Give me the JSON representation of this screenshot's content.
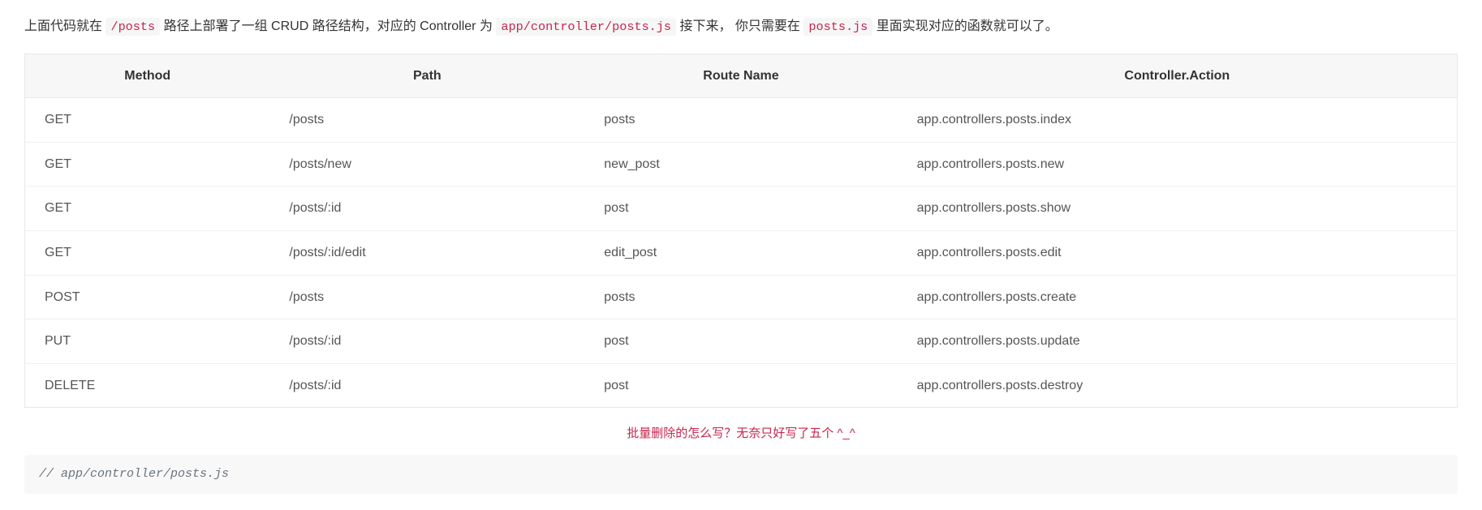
{
  "intro": {
    "part1": "上面代码就在 ",
    "code1": "/posts",
    "part2": " 路径上部署了一组 CRUD 路径结构，对应的 Controller 为 ",
    "code2": "app/controller/posts.js",
    "part3": " 接下来， 你只需要在 ",
    "code3": "posts.js",
    "part4": " 里面实现对应的函数就可以了。"
  },
  "table": {
    "headers": [
      "Method",
      "Path",
      "Route Name",
      "Controller.Action"
    ],
    "rows": [
      {
        "method": "GET",
        "path": "/posts",
        "route_name": "posts",
        "action": "app.controllers.posts.index"
      },
      {
        "method": "GET",
        "path": "/posts/new",
        "route_name": "new_post",
        "action": "app.controllers.posts.new"
      },
      {
        "method": "GET",
        "path": "/posts/:id",
        "route_name": "post",
        "action": "app.controllers.posts.show"
      },
      {
        "method": "GET",
        "path": "/posts/:id/edit",
        "route_name": "edit_post",
        "action": "app.controllers.posts.edit"
      },
      {
        "method": "POST",
        "path": "/posts",
        "route_name": "posts",
        "action": "app.controllers.posts.create"
      },
      {
        "method": "PUT",
        "path": "/posts/:id",
        "route_name": "post",
        "action": "app.controllers.posts.update"
      },
      {
        "method": "DELETE",
        "path": "/posts/:id",
        "route_name": "post",
        "action": "app.controllers.posts.destroy"
      }
    ]
  },
  "note": "批量删除的怎么写？无奈只好写了五个  ^_^",
  "code_block": {
    "comment": "// app/controller/posts.js"
  }
}
